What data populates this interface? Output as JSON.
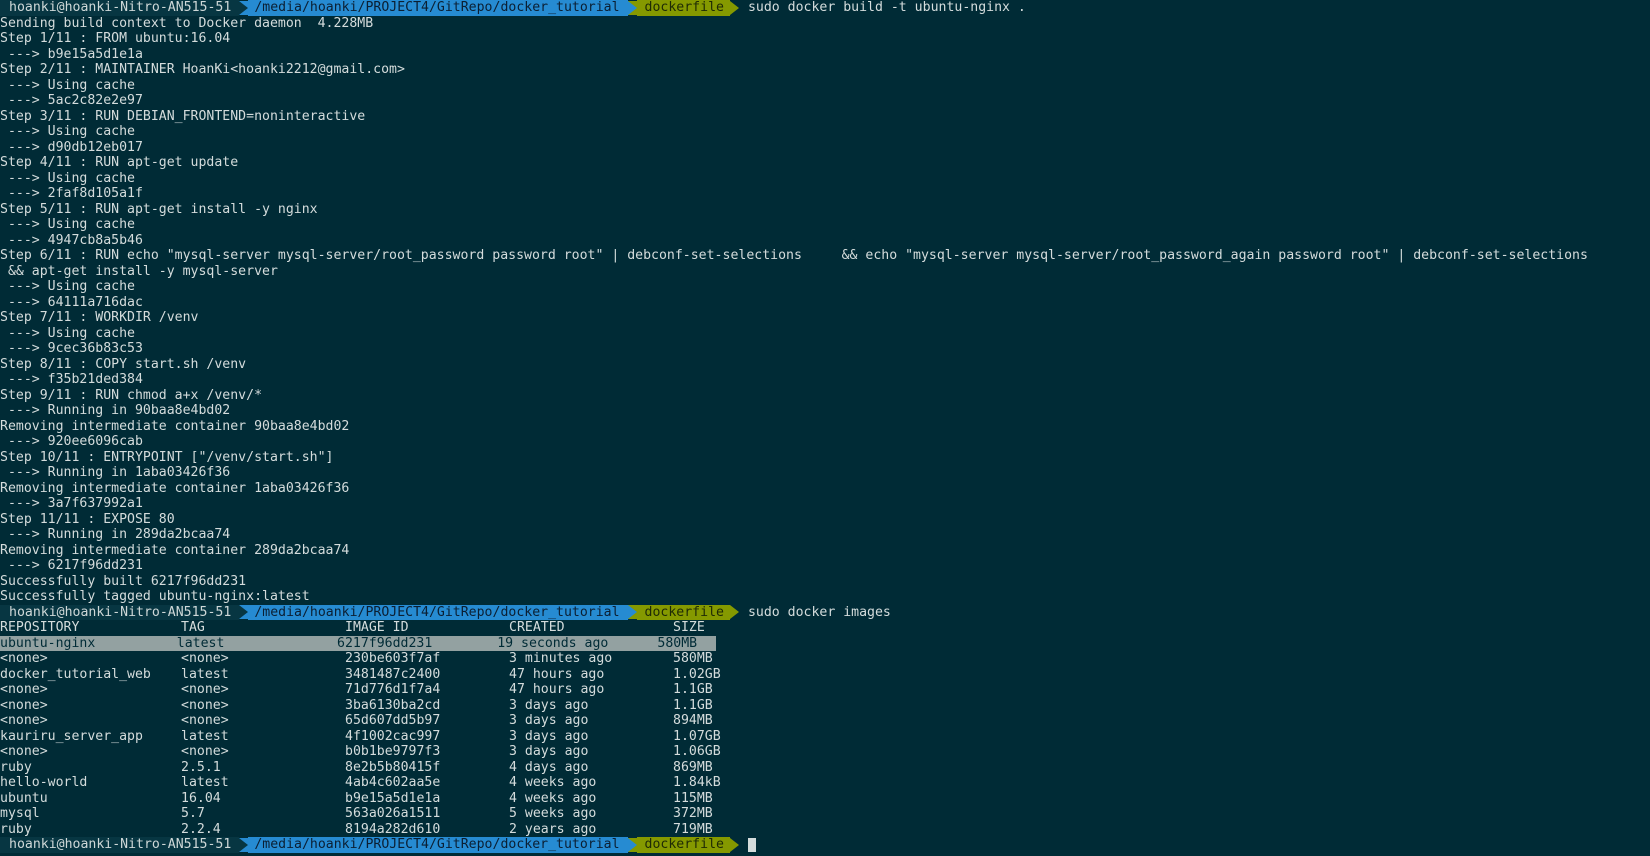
{
  "prompt": {
    "user": "hoanki@hoanki-Nitro-AN515-51",
    "path": "/media/hoanki/PROJECT4/GitRepo/docker_tutorial",
    "branch_icon": "",
    "branch": "dockerfile",
    "colors": {
      "user_bg": "#073642",
      "path_bg": "#268bd2",
      "git_bg": "#859900"
    }
  },
  "commands": {
    "build": "sudo docker build -t ubuntu-nginx .",
    "images": "sudo docker images"
  },
  "build_output": [
    "Sending build context to Docker daemon  4.228MB",
    "Step 1/11 : FROM ubuntu:16.04",
    " ---> b9e15a5d1e1a",
    "Step 2/11 : MAINTAINER HoanKi<hoanki2212@gmail.com>",
    " ---> Using cache",
    " ---> 5ac2c82e2e97",
    "Step 3/11 : RUN DEBIAN_FRONTEND=noninteractive",
    " ---> Using cache",
    " ---> d90db12eb017",
    "Step 4/11 : RUN apt-get update",
    " ---> Using cache",
    " ---> 2faf8d105a1f",
    "Step 5/11 : RUN apt-get install -y nginx",
    " ---> Using cache",
    " ---> 4947cb8a5b46",
    "Step 6/11 : RUN echo \"mysql-server mysql-server/root_password password root\" | debconf-set-selections     && echo \"mysql-server mysql-server/root_password_again password root\" | debconf-set-selections",
    " && apt-get install -y mysql-server",
    " ---> Using cache",
    " ---> 64111a716dac",
    "Step 7/11 : WORKDIR /venv",
    " ---> Using cache",
    " ---> 9cec36b83c53",
    "Step 8/11 : COPY start.sh /venv",
    " ---> f35b21ded384",
    "Step 9/11 : RUN chmod a+x /venv/*",
    " ---> Running in 90baa8e4bd02",
    "Removing intermediate container 90baa8e4bd02",
    " ---> 920ee6096cab",
    "Step 10/11 : ENTRYPOINT [\"/venv/start.sh\"]",
    " ---> Running in 1aba03426f36",
    "Removing intermediate container 1aba03426f36",
    " ---> 3a7f637992a1",
    "Step 11/11 : EXPOSE 80",
    " ---> Running in 289da2bcaa74",
    "Removing intermediate container 289da2bcaa74",
    " ---> 6217f96dd231",
    "Successfully built 6217f96dd231",
    "Successfully tagged ubuntu-nginx:latest"
  ],
  "images_table": {
    "headers": [
      "REPOSITORY",
      "TAG",
      "IMAGE ID",
      "CREATED",
      "SIZE"
    ],
    "rows": [
      [
        "ubuntu-nginx",
        "latest",
        "6217f96dd231",
        "19 seconds ago",
        "580MB"
      ],
      [
        "<none>",
        "<none>",
        "230be603f7af",
        "3 minutes ago",
        "580MB"
      ],
      [
        "docker_tutorial_web",
        "latest",
        "3481487c2400",
        "47 hours ago",
        "1.02GB"
      ],
      [
        "<none>",
        "<none>",
        "71d776d1f7a4",
        "47 hours ago",
        "1.1GB"
      ],
      [
        "<none>",
        "<none>",
        "3ba6130ba2cd",
        "3 days ago",
        "1.1GB"
      ],
      [
        "<none>",
        "<none>",
        "65d607dd5b97",
        "3 days ago",
        "894MB"
      ],
      [
        "kauriru_server_app",
        "latest",
        "4f1002cac997",
        "3 days ago",
        "1.07GB"
      ],
      [
        "<none>",
        "<none>",
        "b0b1be9797f3",
        "3 days ago",
        "1.06GB"
      ],
      [
        "ruby",
        "2.5.1",
        "8e2b5b80415f",
        "4 days ago",
        "869MB"
      ],
      [
        "hello-world",
        "latest",
        "4ab4c602aa5e",
        "4 weeks ago",
        "1.84kB"
      ],
      [
        "ubuntu",
        "16.04",
        "b9e15a5d1e1a",
        "4 weeks ago",
        "115MB"
      ],
      [
        "mysql",
        "5.7",
        "563a026a1511",
        "5 weeks ago",
        "372MB"
      ],
      [
        "ruby",
        "2.2.4",
        "8194a282d610",
        "2 years ago",
        "719MB"
      ]
    ],
    "selected_row": 0
  }
}
